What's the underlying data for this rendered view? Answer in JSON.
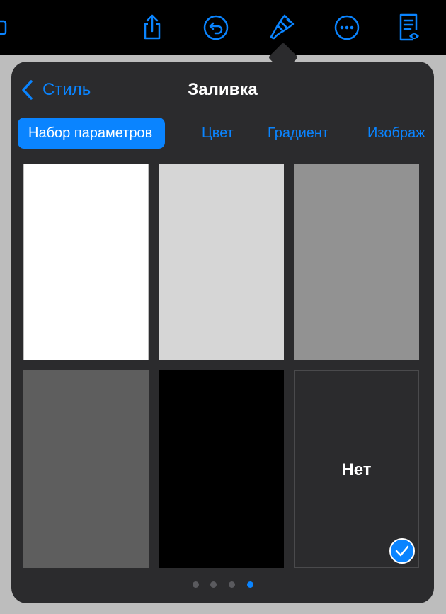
{
  "colors": {
    "accent": "#0a84ff",
    "popover_bg": "#2b2b2d",
    "toolbar_bg": "#000000"
  },
  "toolbar": {
    "icons": [
      "share-icon",
      "undo-icon",
      "paintbrush-icon",
      "more-icon",
      "reader-view-icon"
    ]
  },
  "popover": {
    "back_label": "Стиль",
    "title": "Заливка",
    "tabs": [
      {
        "label": "Набор параметров",
        "active": true
      },
      {
        "label": "Цвет",
        "active": false
      },
      {
        "label": "Градиент",
        "active": false
      },
      {
        "label": "Изображ",
        "active": false
      }
    ],
    "swatches": [
      {
        "name": "white",
        "color": "#ffffff"
      },
      {
        "name": "light-gray",
        "color": "#d6d6d6"
      },
      {
        "name": "gray",
        "color": "#929292"
      },
      {
        "name": "dark-gray",
        "color": "#5e5e5e"
      },
      {
        "name": "black",
        "color": "#000000"
      },
      {
        "name": "none",
        "label": "Нет",
        "selected": true
      }
    ],
    "page_dots": {
      "count": 4,
      "current": 4
    }
  }
}
